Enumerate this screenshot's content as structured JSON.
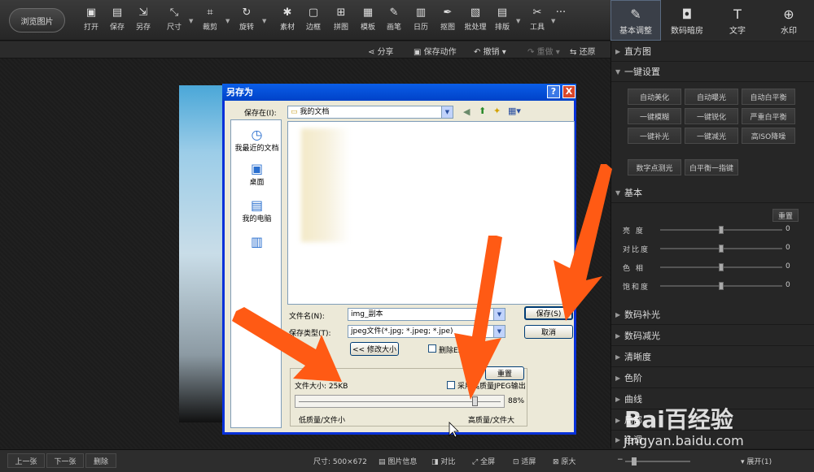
{
  "toolbar": {
    "browse_label": "浏览图片",
    "tools": [
      {
        "label": "打开",
        "icon": "open-icon"
      },
      {
        "label": "保存",
        "icon": "save-icon"
      },
      {
        "label": "另存",
        "icon": "save-as-icon"
      },
      {
        "label": "尺寸",
        "icon": "resize-icon"
      },
      {
        "label": "裁剪",
        "icon": "crop-icon"
      },
      {
        "label": "旋转",
        "icon": "rotate-icon"
      },
      {
        "label": "素材",
        "icon": "material-icon"
      },
      {
        "label": "边框",
        "icon": "border-icon"
      },
      {
        "label": "拼图",
        "icon": "collage-icon"
      },
      {
        "label": "模板",
        "icon": "template-icon"
      },
      {
        "label": "画笔",
        "icon": "brush-icon"
      },
      {
        "label": "日历",
        "icon": "calendar-icon"
      },
      {
        "label": "抠图",
        "icon": "cutout-icon"
      },
      {
        "label": "批处理",
        "icon": "batch-icon"
      },
      {
        "label": "排版",
        "icon": "layout-icon"
      },
      {
        "label": "工具",
        "icon": "tools-icon"
      },
      {
        "label": "···",
        "icon": "more-icon"
      }
    ]
  },
  "right_tabs": [
    {
      "label": "基本调整",
      "icon": "adjust-icon",
      "active": true
    },
    {
      "label": "数码暗房",
      "icon": "darkroom-icon",
      "active": false
    },
    {
      "label": "文字",
      "icon": "text-icon",
      "active": false
    },
    {
      "label": "水印",
      "icon": "watermark-icon",
      "active": false
    }
  ],
  "actionbar": {
    "share": "分享",
    "save_action": "保存动作",
    "undo": "撤销",
    "redo": "重做",
    "restore": "还原"
  },
  "panel": {
    "histogram": "直方图",
    "one_key": "一键设置",
    "one_key_buttons": [
      "自动美化",
      "自动曝光",
      "自动白平衡",
      "一键模糊",
      "一键锐化",
      "严重白平衡",
      "一键补光",
      "一键减光",
      "高ISO降噪"
    ],
    "extra_buttons": [
      "数字点测光",
      "白平衡一指键"
    ],
    "basic": "基本",
    "reset": "重置",
    "sliders": [
      {
        "label": "亮  度",
        "value": "0",
        "level": 0.5
      },
      {
        "label": "对比度",
        "value": "0",
        "level": 0.5
      },
      {
        "label": "色  相",
        "value": "0",
        "level": 0.5
      },
      {
        "label": "饱和度",
        "value": "0",
        "level": 0.5
      }
    ],
    "sections": [
      "数码补光",
      "数码减光",
      "清晰度",
      "色阶",
      "曲线",
      "局部",
      "色调"
    ]
  },
  "dialog": {
    "title": "另存为",
    "help": "?",
    "close": "X",
    "save_in_label": "保存在(I):",
    "save_in_value": "我的文档",
    "places": [
      "我最近的文档",
      "桌面",
      "我的电脑",
      ""
    ],
    "filename_label": "文件名(N):",
    "filename_value": "img_副本",
    "filetype_label": "保存类型(T):",
    "filetype_value": "jpeg文件(*.jpg; *.jpeg; *.jpe)",
    "size_label": "大小(S):",
    "resize_button": "<< 修改大小",
    "remove_exif": "删除EXIF",
    "save_button": "保存(S)",
    "cancel_button": "取消",
    "reset_button": "重置",
    "file_size": "文件大小: 25KB",
    "high_quality": "采用高质量JPEG输出",
    "quality_value": "88%",
    "quality_level": 0.88,
    "low_quality": "低质量/文件小",
    "high_quality_label": "高质量/文件大"
  },
  "bottombar": {
    "prev": "上一张",
    "next": "下一张",
    "delete": "删除",
    "size": "尺寸: 500×672",
    "info": "图片信息",
    "compare": "对比",
    "fullscreen": "全屏",
    "fit": "适屏",
    "original": "原大",
    "expand": "展开(1)"
  },
  "watermark": {
    "brand": "Bai百经验",
    "url": "jingyan.baidu.com"
  },
  "colors": {
    "accent_arrow": "#ff5a14",
    "dialog_title": "#0a5ee8"
  }
}
